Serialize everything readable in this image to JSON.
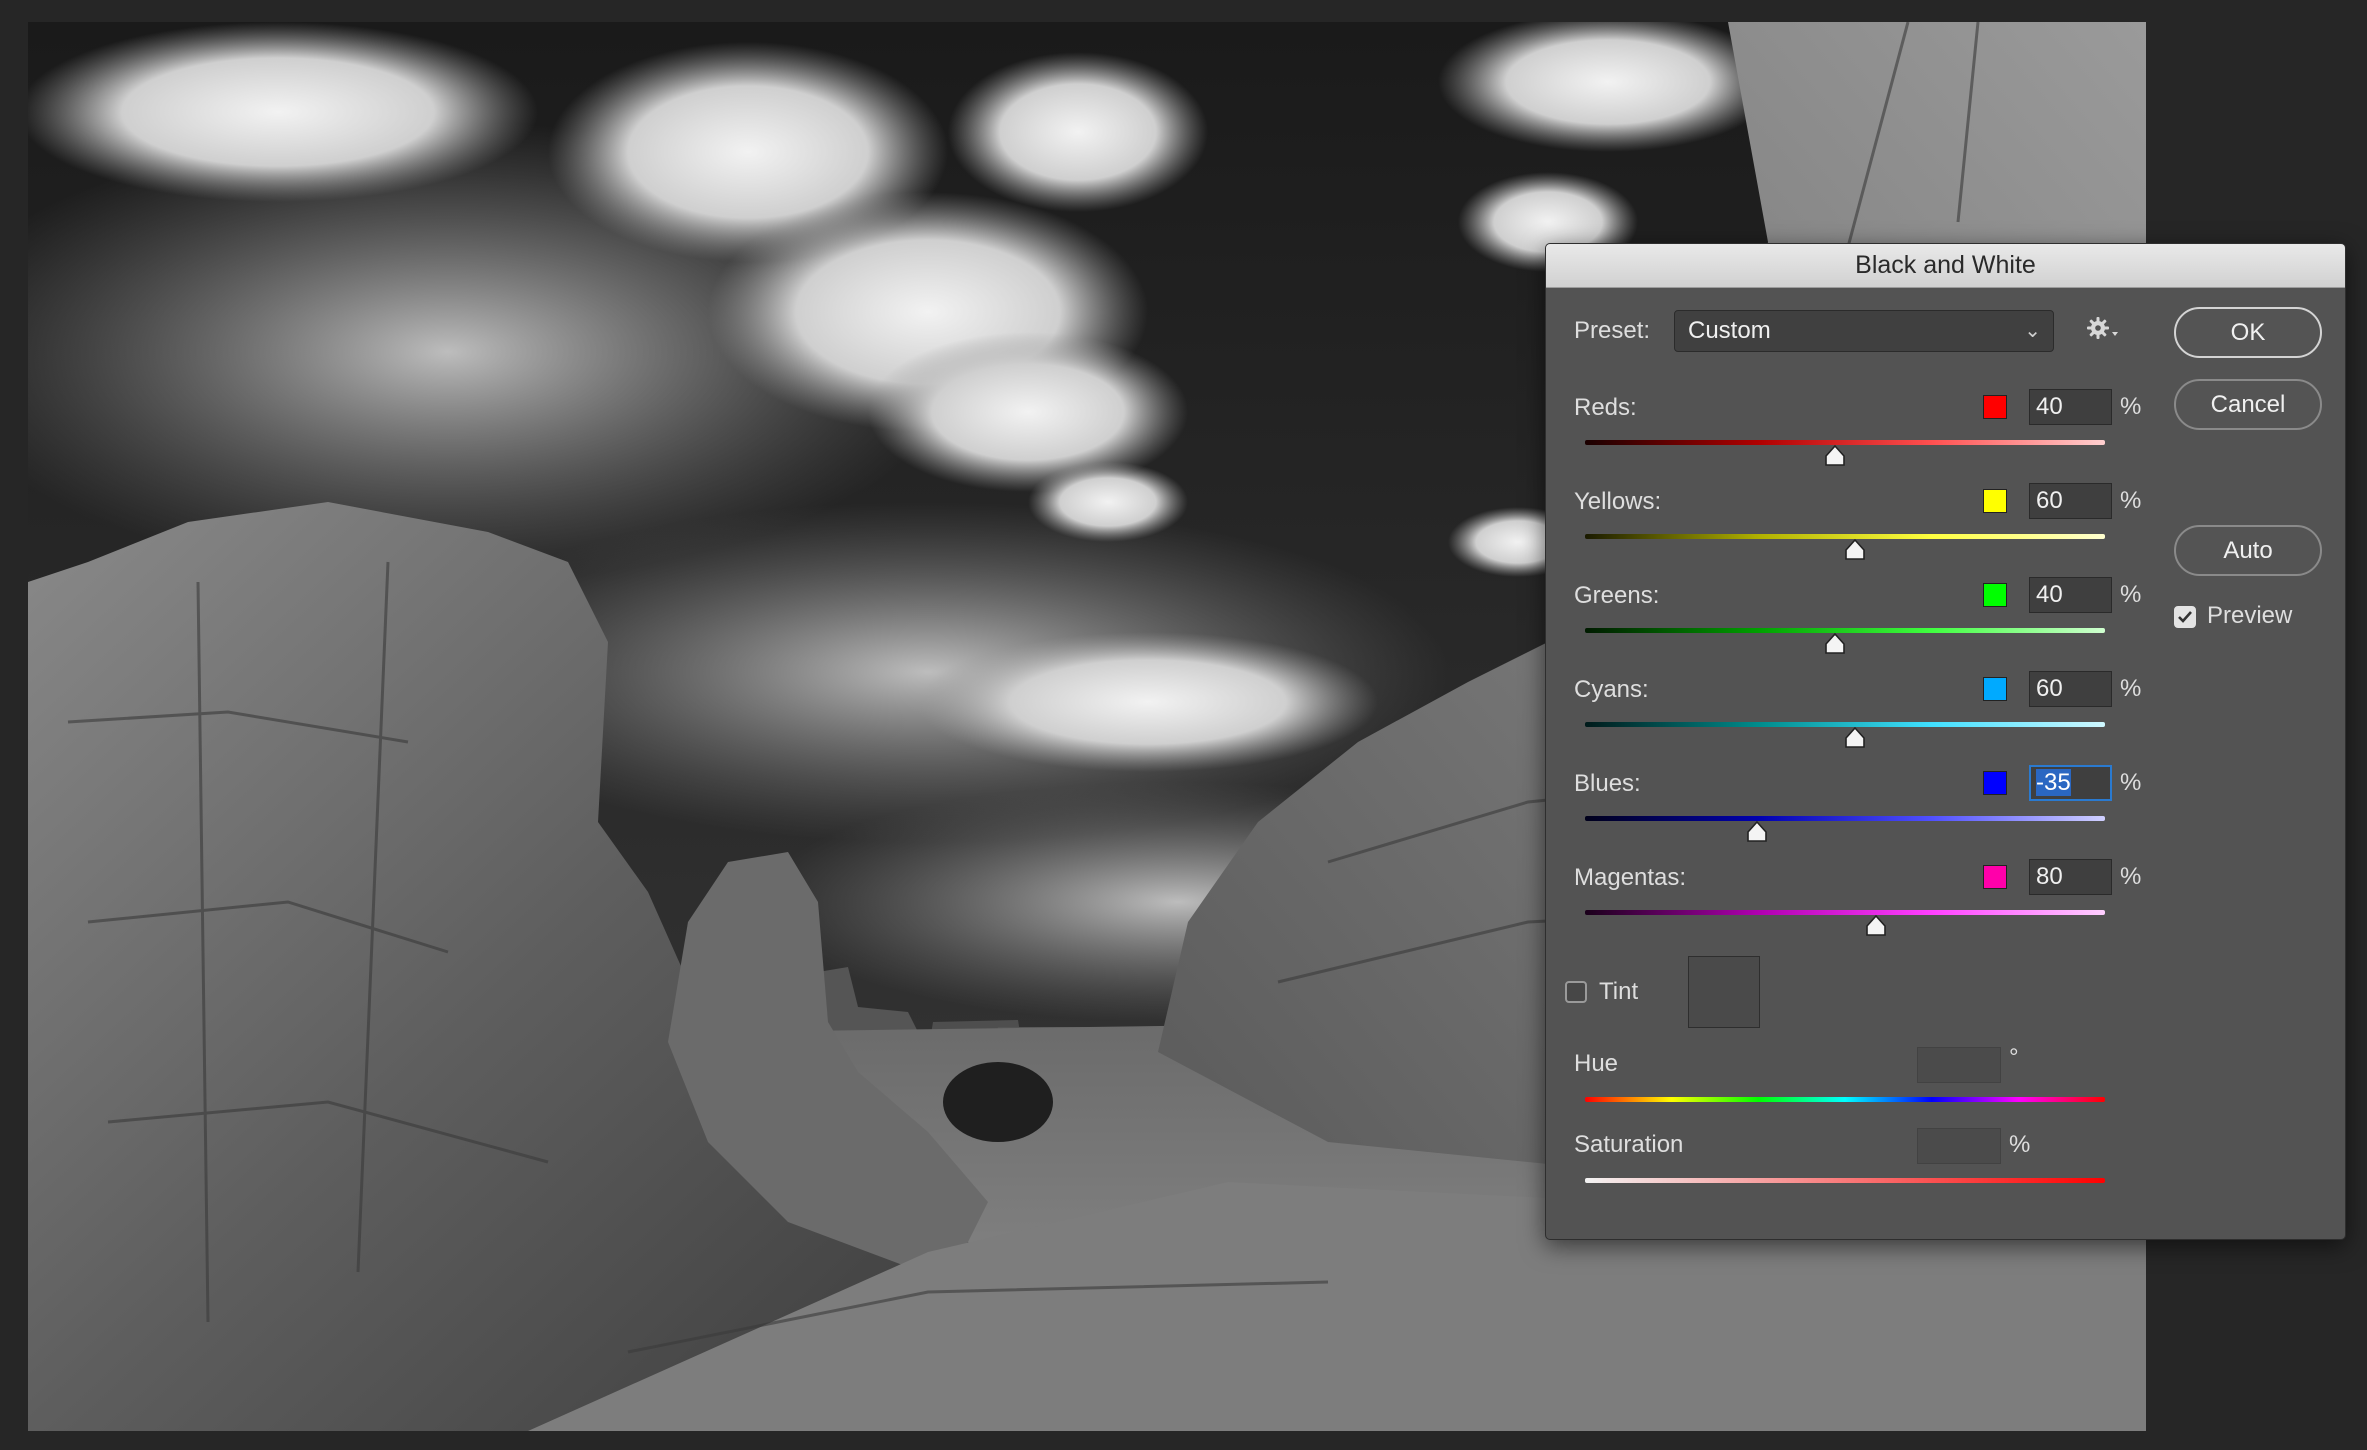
{
  "dialog": {
    "title": "Black and White",
    "preset_label": "Preset:",
    "preset_value": "Custom",
    "buttons": {
      "ok": "OK",
      "cancel": "Cancel",
      "auto": "Auto"
    },
    "preview": {
      "label": "Preview",
      "checked": true
    },
    "sliders": [
      {
        "key": "reds",
        "label": "Reds:",
        "value": "40",
        "unit": "%",
        "color": "#ff0000"
      },
      {
        "key": "yellows",
        "label": "Yellows:",
        "value": "60",
        "unit": "%",
        "color": "#ffff00"
      },
      {
        "key": "greens",
        "label": "Greens:",
        "value": "40",
        "unit": "%",
        "color": "#00ff00"
      },
      {
        "key": "cyans",
        "label": "Cyans:",
        "value": "60",
        "unit": "%",
        "color": "#00aaff"
      },
      {
        "key": "blues",
        "label": "Blues:",
        "value": "-35",
        "unit": "%",
        "color": "#0000ff"
      },
      {
        "key": "magentas",
        "label": "Magentas:",
        "value": "80",
        "unit": "%",
        "color": "#ff00aa"
      }
    ],
    "tint": {
      "label": "Tint",
      "checked": false
    },
    "hue": {
      "label": "Hue",
      "unit": "°"
    },
    "saturation": {
      "label": "Saturation",
      "unit": "%"
    }
  }
}
